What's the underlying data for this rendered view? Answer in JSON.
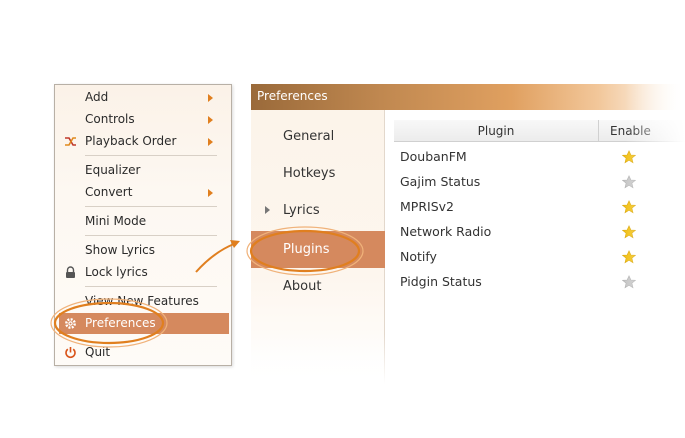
{
  "menu": {
    "items": [
      {
        "label": "Add",
        "submenu": true
      },
      {
        "label": "Controls",
        "submenu": true
      },
      {
        "label": "Playback Order",
        "submenu": true,
        "icon": "shuffle-icon"
      },
      {
        "label": "Equalizer"
      },
      {
        "label": "Convert",
        "submenu": true
      },
      {
        "label": "Mini Mode"
      },
      {
        "label": "Show Lyrics"
      },
      {
        "label": "Lock lyrics",
        "icon": "lock-icon"
      },
      {
        "label": "View New Features"
      },
      {
        "label": "Preferences",
        "icon": "gear-icon",
        "selected": true
      },
      {
        "label": "Quit",
        "icon": "power-icon"
      }
    ]
  },
  "window": {
    "title": "Preferences",
    "sidebar": [
      {
        "label": "General"
      },
      {
        "label": "Hotkeys"
      },
      {
        "label": "Lyrics",
        "expander": true
      },
      {
        "label": "Plugins",
        "active": true
      },
      {
        "label": "About"
      }
    ],
    "table": {
      "columns": [
        "Plugin",
        "Enable"
      ],
      "rows": [
        {
          "name": "DoubanFM",
          "enabled": true
        },
        {
          "name": "Gajim Status",
          "enabled": false
        },
        {
          "name": "MPRISv2",
          "enabled": true
        },
        {
          "name": "Network Radio",
          "enabled": true
        },
        {
          "name": "Notify",
          "enabled": true
        },
        {
          "name": "Pidgin Status",
          "enabled": false
        }
      ]
    }
  },
  "colors": {
    "accent": "#d5895e",
    "annotation": "#e07f1f",
    "star_on": "#f2c21a",
    "star_off": "#c8c8c8"
  }
}
